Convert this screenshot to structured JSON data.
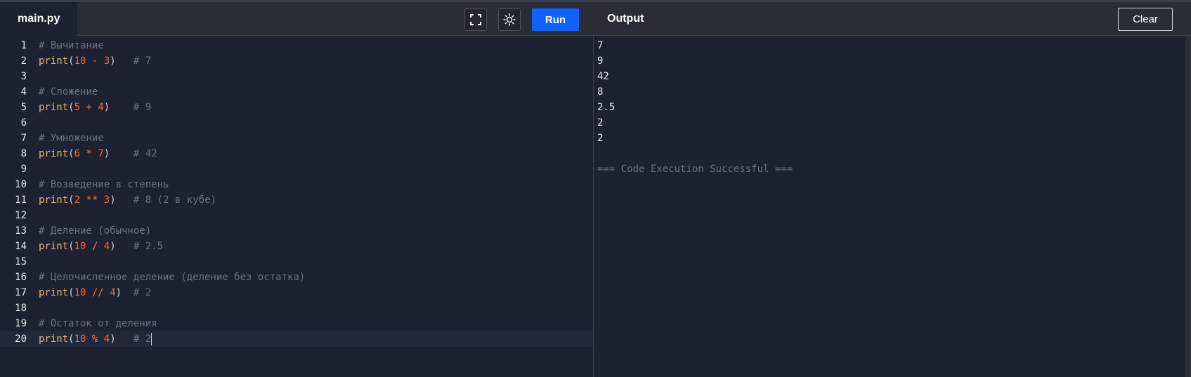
{
  "header": {
    "file_tab": "main.py",
    "run_label": "Run",
    "output_title": "Output",
    "clear_label": "Clear",
    "fullscreen_icon": "fullscreen-icon",
    "theme_icon": "sun-icon"
  },
  "editor": {
    "lines": [
      {
        "n": "1",
        "tokens": [
          [
            "comment",
            "# Вычитание"
          ]
        ]
      },
      {
        "n": "2",
        "tokens": [
          [
            "fn",
            "print"
          ],
          [
            "paren",
            "("
          ],
          [
            "num",
            "10"
          ],
          [
            "op",
            " - "
          ],
          [
            "num",
            "3"
          ],
          [
            "paren",
            ")"
          ],
          [
            "text",
            "   "
          ],
          [
            "comment",
            "# 7"
          ]
        ]
      },
      {
        "n": "3",
        "tokens": []
      },
      {
        "n": "4",
        "tokens": [
          [
            "comment",
            "# Сложение"
          ]
        ]
      },
      {
        "n": "5",
        "tokens": [
          [
            "fn",
            "print"
          ],
          [
            "paren",
            "("
          ],
          [
            "num",
            "5"
          ],
          [
            "op",
            " + "
          ],
          [
            "num",
            "4"
          ],
          [
            "paren",
            ")"
          ],
          [
            "text",
            "    "
          ],
          [
            "comment",
            "# 9"
          ]
        ]
      },
      {
        "n": "6",
        "tokens": []
      },
      {
        "n": "7",
        "tokens": [
          [
            "comment",
            "# Умножение"
          ]
        ]
      },
      {
        "n": "8",
        "tokens": [
          [
            "fn",
            "print"
          ],
          [
            "paren",
            "("
          ],
          [
            "num",
            "6"
          ],
          [
            "op",
            " * "
          ],
          [
            "num",
            "7"
          ],
          [
            "paren",
            ")"
          ],
          [
            "text",
            "    "
          ],
          [
            "comment",
            "# 42"
          ]
        ]
      },
      {
        "n": "9",
        "tokens": []
      },
      {
        "n": "10",
        "tokens": [
          [
            "comment",
            "# Возведение в степень"
          ]
        ]
      },
      {
        "n": "11",
        "tokens": [
          [
            "fn",
            "print"
          ],
          [
            "paren",
            "("
          ],
          [
            "num",
            "2"
          ],
          [
            "op",
            " ** "
          ],
          [
            "num",
            "3"
          ],
          [
            "paren",
            ")"
          ],
          [
            "text",
            "   "
          ],
          [
            "comment",
            "# 8 (2 в кубе)"
          ]
        ]
      },
      {
        "n": "12",
        "tokens": []
      },
      {
        "n": "13",
        "tokens": [
          [
            "comment",
            "# Деление (обычное)"
          ]
        ]
      },
      {
        "n": "14",
        "tokens": [
          [
            "fn",
            "print"
          ],
          [
            "paren",
            "("
          ],
          [
            "num",
            "10"
          ],
          [
            "op",
            " / "
          ],
          [
            "num",
            "4"
          ],
          [
            "paren",
            ")"
          ],
          [
            "text",
            "   "
          ],
          [
            "comment",
            "# 2.5"
          ]
        ]
      },
      {
        "n": "15",
        "tokens": []
      },
      {
        "n": "16",
        "tokens": [
          [
            "comment",
            "# Целочисленное деление (деление без остатка)"
          ]
        ]
      },
      {
        "n": "17",
        "tokens": [
          [
            "fn",
            "print"
          ],
          [
            "paren",
            "("
          ],
          [
            "num",
            "10"
          ],
          [
            "op",
            " // "
          ],
          [
            "num",
            "4"
          ],
          [
            "paren",
            ")"
          ],
          [
            "text",
            "  "
          ],
          [
            "comment",
            "# 2"
          ]
        ]
      },
      {
        "n": "18",
        "tokens": []
      },
      {
        "n": "19",
        "tokens": [
          [
            "comment",
            "# Остаток от деления"
          ]
        ]
      },
      {
        "n": "20",
        "tokens": [
          [
            "fn",
            "print"
          ],
          [
            "paren",
            "("
          ],
          [
            "num",
            "10"
          ],
          [
            "op",
            " % "
          ],
          [
            "num",
            "4"
          ],
          [
            "paren",
            ")"
          ],
          [
            "text",
            "   "
          ],
          [
            "comment",
            "# 2"
          ]
        ],
        "active": true
      }
    ]
  },
  "output": {
    "lines": [
      "7",
      "9",
      "42",
      "8",
      "2.5",
      "2",
      "2",
      ""
    ],
    "status": "=== Code Execution Successful ==="
  },
  "colors": {
    "background": "#1d2130",
    "header": "#2b2d36",
    "accent": "#0f62fe",
    "comment": "#6b717f",
    "function": "#e6b673",
    "number": "#ef6b3a"
  }
}
